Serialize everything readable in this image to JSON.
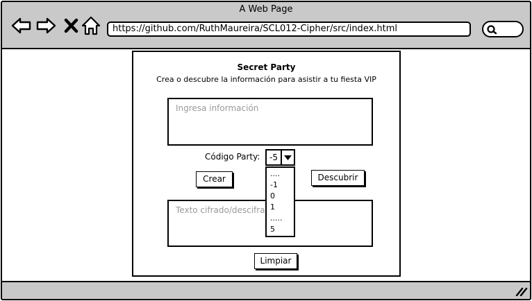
{
  "browser": {
    "title": "A Web Page",
    "url": "https://github.com/RuthMaureira/SCL012-Cipher/src/index.html",
    "icons": [
      "back-arrow-icon",
      "forward-arrow-icon",
      "close-x-icon",
      "home-icon",
      "search-icon",
      "resize-grip-icon"
    ]
  },
  "page": {
    "title": "Secret Party",
    "subtitle": "Crea o descubre la información para asistir a tu fiesta VIP",
    "input_placeholder": "Ingresa información",
    "code_label": "Código Party:",
    "code_selected": "-5",
    "code_options": [
      "....",
      "-1",
      "0",
      "1",
      ".....",
      "5"
    ],
    "crear_label": "Crear",
    "descubrir_label": "Descubrir",
    "output_placeholder": "Texto cifrado/descifra",
    "limpiar_label": "Limpiar"
  }
}
